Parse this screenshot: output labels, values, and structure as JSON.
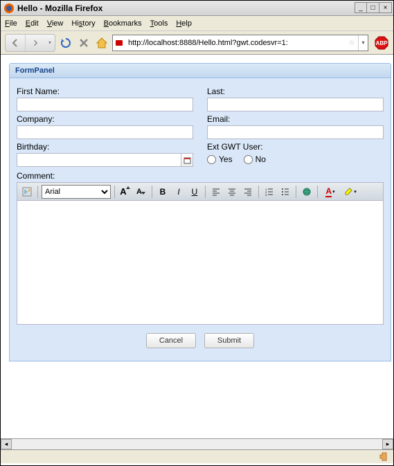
{
  "window": {
    "title": "Hello - Mozilla Firefox"
  },
  "menubar": {
    "file": "File",
    "edit": "Edit",
    "view": "View",
    "history": "History",
    "bookmarks": "Bookmarks",
    "tools": "Tools",
    "help": "Help"
  },
  "addressbar": {
    "url": "http://localhost:8888/Hello.html?gwt.codesvr=1:"
  },
  "panel": {
    "title": "FormPanel"
  },
  "form": {
    "first_name_label": "First Name:",
    "first_name_value": "",
    "last_label": "Last:",
    "last_value": "",
    "company_label": "Company:",
    "company_value": "",
    "email_label": "Email:",
    "email_value": "",
    "birthday_label": "Birthday:",
    "birthday_value": "",
    "extgwt_label": "Ext GWT User:",
    "radio_yes": "Yes",
    "radio_no": "No",
    "comment_label": "Comment:",
    "font_selected": "Arial"
  },
  "buttons": {
    "cancel": "Cancel",
    "submit": "Submit"
  }
}
